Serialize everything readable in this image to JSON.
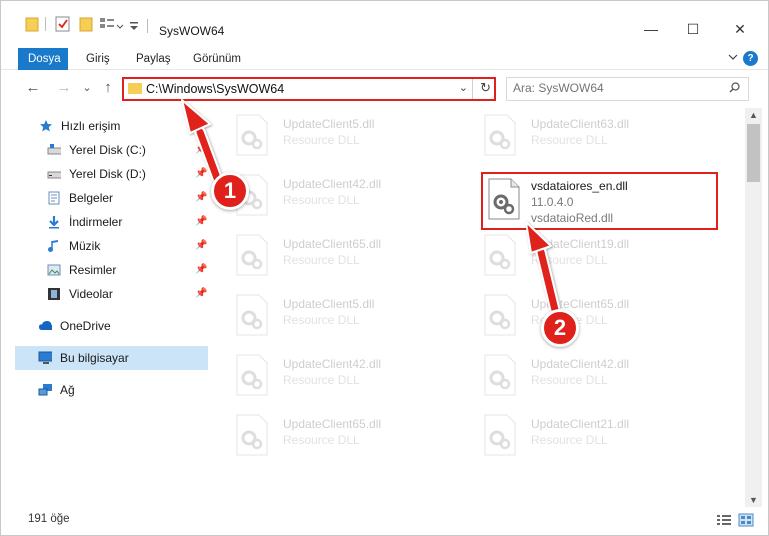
{
  "window": {
    "title": "SysWOW64",
    "controls": {
      "minimize": "—",
      "maximize": "☐",
      "close": "✕"
    }
  },
  "ribbon": {
    "tabs": [
      {
        "label": "Dosya",
        "active": true
      },
      {
        "label": "Giriş",
        "active": false
      },
      {
        "label": "Paylaş",
        "active": false
      },
      {
        "label": "Görünüm",
        "active": false
      }
    ],
    "collapse_icon": "chevron-down-icon",
    "help_label": "?"
  },
  "nav": {
    "back_icon": "←",
    "forward_icon": "→",
    "recent_icon": "⌄",
    "up_icon": "↑",
    "address": "C:\\Windows\\SysWOW64",
    "dropdown_icon": "⌄",
    "refresh_icon": "↻",
    "search_placeholder": "Ara: SysWOW64"
  },
  "sidebar": {
    "items": [
      {
        "label": "Hızlı erişim",
        "icon": "star-icon",
        "pinned": false
      },
      {
        "label": "Yerel Disk (C:)",
        "icon": "drive-icon",
        "pinned": true
      },
      {
        "label": "Yerel Disk (D:)",
        "icon": "drive-icon",
        "pinned": true
      },
      {
        "label": "Belgeler",
        "icon": "documents-icon",
        "pinned": true
      },
      {
        "label": "İndirmeler",
        "icon": "download-icon",
        "pinned": true
      },
      {
        "label": "Müzik",
        "icon": "music-icon",
        "pinned": true
      },
      {
        "label": "Resimler",
        "icon": "pictures-icon",
        "pinned": true
      },
      {
        "label": "Videolar",
        "icon": "video-icon",
        "pinned": true
      },
      {
        "label": "OneDrive",
        "icon": "cloud-icon",
        "pinned": false
      },
      {
        "label": "Bu bilgisayar",
        "icon": "computer-icon",
        "pinned": false,
        "selected": true
      },
      {
        "label": "Ağ",
        "icon": "network-icon",
        "pinned": false
      }
    ],
    "pin_glyph": "📌"
  },
  "files": {
    "left_column": [
      {
        "name": "UpdateClient5.dll",
        "desc": "Resource DLL"
      },
      {
        "name": "UpdateClient42.dll",
        "desc": "Resource DLL"
      },
      {
        "name": "UpdateClient65.dll",
        "desc": "Resource DLL"
      },
      {
        "name": "UpdateClient5.dll",
        "desc": "Resource DLL"
      },
      {
        "name": "UpdateClient42.dll",
        "desc": "Resource DLL"
      },
      {
        "name": "UpdateClient65.dll",
        "desc": "Resource DLL"
      }
    ],
    "right_column": [
      {
        "name": "UpdateClient63.dll",
        "desc": "Resource DLL"
      },
      {
        "name": "UpdateClient19.dll",
        "desc": "Resource DLL"
      },
      {
        "name": "UpdateClient65.dll",
        "desc": "Resource DLL"
      },
      {
        "name": "UpdateClient42.dll",
        "desc": "Resource DLL"
      },
      {
        "name": "UpdateClient21.dll",
        "desc": "Resource DLL"
      }
    ],
    "highlighted": {
      "name": "vsdataiores_en.dll",
      "version": "11.0.4.0",
      "desc": "vsdataioRed.dll"
    }
  },
  "status": {
    "item_count": "191 öğe"
  },
  "annotations": {
    "badge_1": "1",
    "badge_2": "2",
    "accent_color": "#e0201a"
  }
}
